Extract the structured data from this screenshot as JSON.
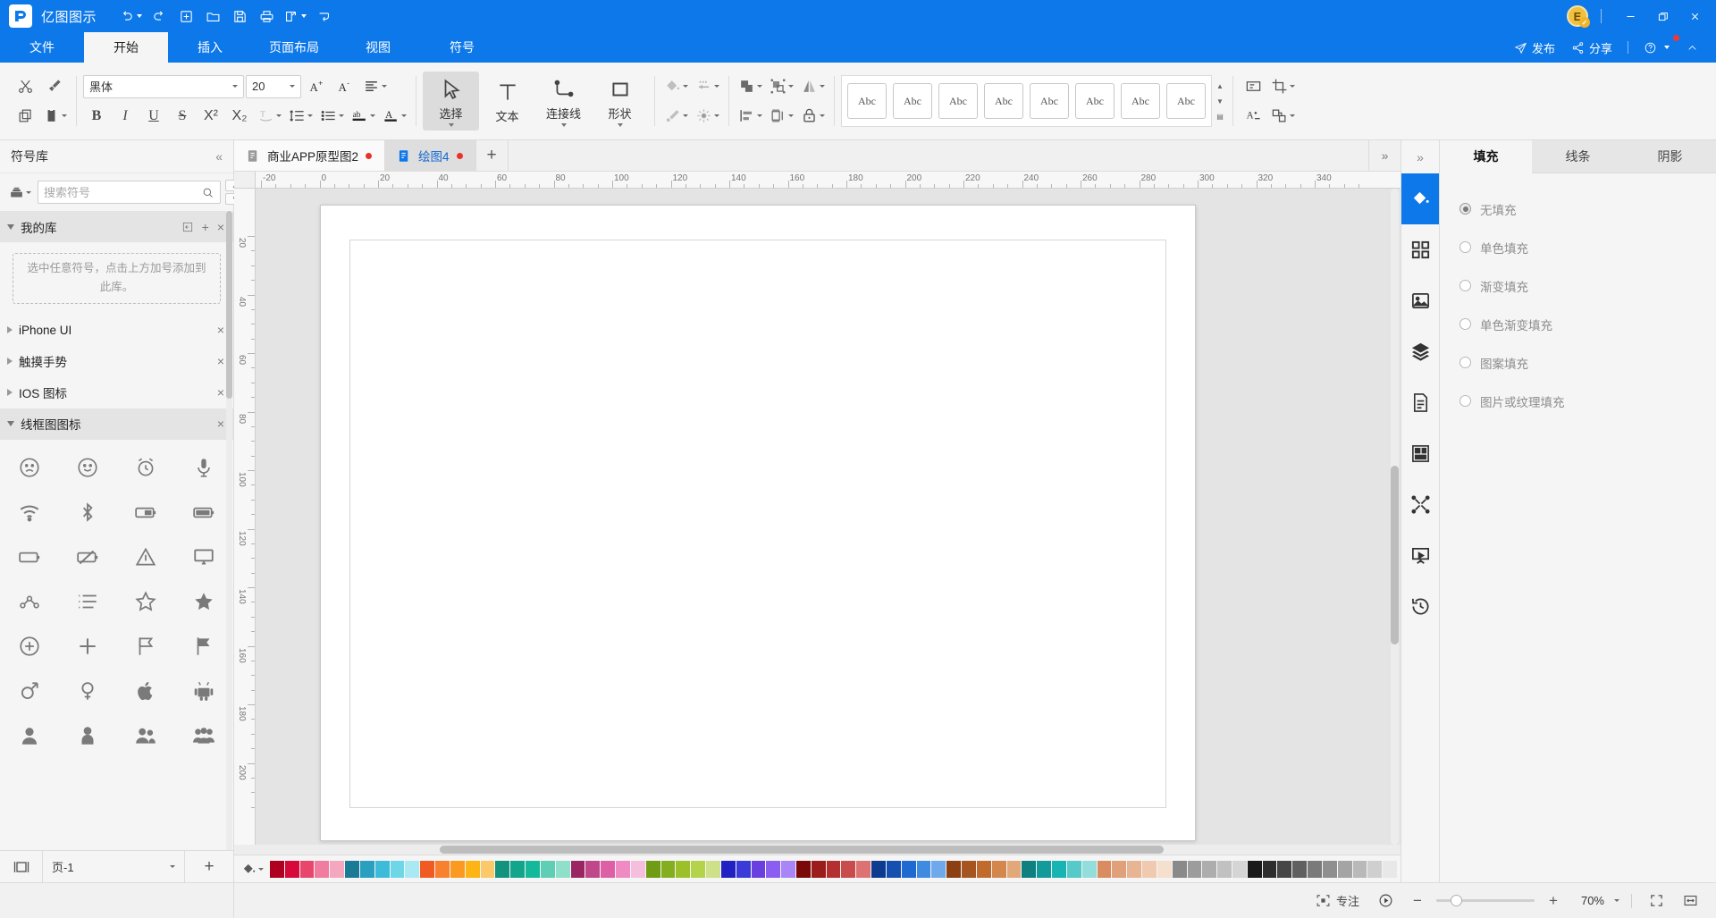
{
  "titlebar": {
    "app_name": "亿图图示",
    "quick_tools": [
      {
        "name": "undo",
        "icon": "undo-icon",
        "has_caret": true
      },
      {
        "name": "redo",
        "icon": "redo-icon",
        "has_caret": false
      },
      {
        "name": "new",
        "icon": "new-file-icon",
        "has_caret": false
      },
      {
        "name": "open",
        "icon": "open-folder-icon",
        "has_caret": false
      },
      {
        "name": "save",
        "icon": "save-icon",
        "has_caret": false
      },
      {
        "name": "print",
        "icon": "print-icon",
        "has_caret": false
      },
      {
        "name": "export",
        "icon": "export-icon",
        "has_caret": true
      },
      {
        "name": "more",
        "icon": "customize-icon",
        "has_caret": false
      }
    ],
    "avatar_letter": "E",
    "window_buttons": [
      "minimize",
      "maximize",
      "close"
    ]
  },
  "menubar": {
    "tabs": [
      {
        "label": "文件",
        "active": false
      },
      {
        "label": "开始",
        "active": true
      },
      {
        "label": "插入",
        "active": false
      },
      {
        "label": "页面布局",
        "active": false
      },
      {
        "label": "视图",
        "active": false
      },
      {
        "label": "符号",
        "active": false
      }
    ],
    "publish_label": "发布",
    "share_label": "分享"
  },
  "ribbon": {
    "clipboard": {
      "cut": "剪切",
      "format_painter": "格式刷",
      "copy": "复制",
      "paste": "粘贴"
    },
    "font": {
      "family": "黑体",
      "size": "20",
      "increase": "增大字号",
      "decrease": "减小字号",
      "align": "对齐"
    },
    "tools": [
      {
        "label": "选择",
        "icon": "cursor-arrow-icon",
        "active": true,
        "caret": true
      },
      {
        "label": "文本",
        "icon": "text-T-icon",
        "active": false,
        "caret": false
      },
      {
        "label": "连接线",
        "icon": "connector-icon",
        "active": false,
        "caret": true
      },
      {
        "label": "形状",
        "icon": "rectangle-icon",
        "active": false,
        "caret": true
      }
    ],
    "style_group": {
      "fill": "填充",
      "line": "线条",
      "pen": "画笔",
      "effect": "效果"
    },
    "arrange_group": {
      "group": "组合",
      "ungroup": "取消组合",
      "flip": "翻转",
      "align": "对齐",
      "distribute": "分布",
      "lock": "锁定"
    },
    "gallery_items": [
      "Abc",
      "Abc",
      "Abc",
      "Abc",
      "Abc",
      "Abc",
      "Abc",
      "Abc"
    ],
    "right_tools": {
      "crop_area": "裁剪区域",
      "crop": "裁剪",
      "text_style": "文本样式",
      "replace": "替换"
    }
  },
  "left_panel": {
    "title": "符号库",
    "collapse_icon": "double-chevron-left-icon",
    "search_placeholder": "搜索符号",
    "libraries": [
      {
        "name": "我的库",
        "open": true,
        "is_mylib": true,
        "empty_text": "选中任意符号，点击上方加号添加到此库。"
      },
      {
        "name": "iPhone UI",
        "open": false
      },
      {
        "name": "触摸手势",
        "open": false
      },
      {
        "name": "IOS 图标",
        "open": false
      },
      {
        "name": "线框图图标",
        "open": true
      }
    ],
    "symbols": [
      "sad-face-icon",
      "smile-face-icon",
      "alarm-clock-icon",
      "microphone-icon",
      "wifi-icon",
      "bluetooth-icon",
      "battery-half-icon",
      "battery-full-icon",
      "battery-empty-icon",
      "battery-off-icon",
      "warning-triangle-icon",
      "monitor-icon",
      "share-node-icon",
      "ordered-list-icon",
      "star-outline-icon",
      "star-filled-icon",
      "plus-circle-icon",
      "plus-icon",
      "flag-outline-icon",
      "flag-filled-icon",
      "male-icon",
      "female-icon",
      "apple-icon",
      "android-icon",
      "user-icon",
      "person-icon",
      "users-two-icon",
      "users-group-icon"
    ],
    "footer": {
      "page_label": "页-1",
      "layout_icon": "page-layout-icon",
      "add_icon": "add-page-icon"
    }
  },
  "doc_tabs": {
    "tabs": [
      {
        "label": "商业APP原型图2",
        "active": false,
        "modified": true
      },
      {
        "label": "绘图4",
        "active": true,
        "modified": true
      }
    ],
    "add_label": "+",
    "overflow_icon": "double-chevron-right-icon"
  },
  "canvas": {
    "ruler_top_labels": [
      "-20",
      "0",
      "20",
      "40",
      "60",
      "80",
      "100",
      "120",
      "140",
      "160",
      "180",
      "200",
      "220",
      "240",
      "260",
      "280",
      "300",
      "320",
      "340"
    ],
    "ruler_left_labels": [
      "20",
      "40",
      "60",
      "80",
      "100",
      "120",
      "140",
      "160",
      "180",
      "200"
    ]
  },
  "palette": {
    "fill_icon": "paint-bucket-icon",
    "colors": [
      "#b00020",
      "#d6093a",
      "#e8466d",
      "#f07ca0",
      "#f4a8bf",
      "#1b7a96",
      "#2a9fc0",
      "#3cbcd8",
      "#6fd6e8",
      "#a9e9f4",
      "#f05a23",
      "#f7812e",
      "#fb9a20",
      "#fdb515",
      "#fbc96a",
      "#13927e",
      "#13a58c",
      "#13b99a",
      "#5ecfb4",
      "#8fe0cb",
      "#9b2562",
      "#c1478b",
      "#dd5fa6",
      "#ef8bc2",
      "#f6bedd",
      "#6f9b15",
      "#84ad1f",
      "#9cc02a",
      "#b4d24a",
      "#cfe08a",
      "#2222c4",
      "#3b3bd8",
      "#6a3fe0",
      "#8a5ef0",
      "#a986f7",
      "#7a0a0a",
      "#9c1b1b",
      "#b43030",
      "#c94c4c",
      "#dd7272",
      "#0d3b8f",
      "#1550b0",
      "#1f6ad0",
      "#3f8be0",
      "#6fa9ec",
      "#8b3f12",
      "#a65420",
      "#c06a2c",
      "#d3874c",
      "#e2a87a",
      "#0f7f7f",
      "#139a9a",
      "#18b3b3",
      "#56c9c9",
      "#93dddd",
      "#d98c5f",
      "#e0a07a",
      "#e8b594",
      "#efcab0",
      "#f5dfcd",
      "#8a8a8a",
      "#9c9c9c",
      "#adadad",
      "#c1c1c1",
      "#d5d5d5",
      "#1a1a1a",
      "#2e2e2e",
      "#464646",
      "#606060",
      "#7a7a7a",
      "#8f8f8f",
      "#a4a4a4",
      "#b9b9b9",
      "#cfcfcf",
      "#e8e8e8"
    ]
  },
  "right_rail": {
    "collapse_icon": "double-chevron-right-icon",
    "buttons": [
      {
        "name": "fill-style-icon",
        "active": true
      },
      {
        "name": "quick-shapes-icon",
        "active": false
      },
      {
        "name": "image-icon",
        "active": false
      },
      {
        "name": "layers-icon",
        "active": false
      },
      {
        "name": "properties-icon",
        "active": false
      },
      {
        "name": "components-icon",
        "active": false
      },
      {
        "name": "connector-style-icon",
        "active": false
      },
      {
        "name": "presentation-icon",
        "active": false
      },
      {
        "name": "history-icon",
        "active": false
      }
    ]
  },
  "right_panel": {
    "tabs": [
      {
        "label": "填充",
        "active": true
      },
      {
        "label": "线条",
        "active": false
      },
      {
        "label": "阴影",
        "active": false
      }
    ],
    "fill_options": [
      {
        "label": "无填充",
        "selected": true
      },
      {
        "label": "单色填充",
        "selected": false
      },
      {
        "label": "渐变填充",
        "selected": false
      },
      {
        "label": "单色渐变填充",
        "selected": false
      },
      {
        "label": "图案填充",
        "selected": false
      },
      {
        "label": "图片或纹理填充",
        "selected": false
      }
    ]
  },
  "statusbar": {
    "focus_label": "专注",
    "focus_icon": "focus-mode-icon",
    "play_icon": "presentation-play-icon",
    "zoom_out": "−",
    "zoom_in": "+",
    "zoom_value": "70%",
    "fit_page_icon": "fit-page-icon",
    "fit_width_icon": "fit-width-icon"
  }
}
